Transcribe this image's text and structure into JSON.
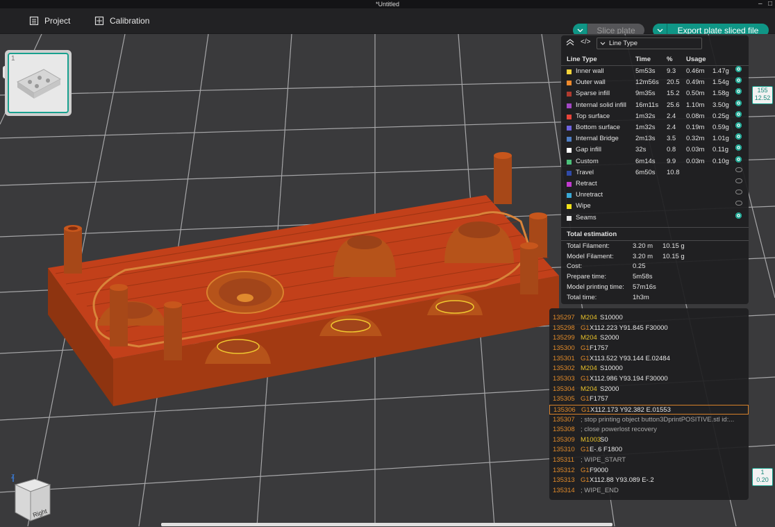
{
  "window": {
    "title": "*Untitled"
  },
  "menubar": {
    "project_label": "Project",
    "calibration_label": "Calibration",
    "slice_label": "Slice plate",
    "export_label": "Export plate sliced file"
  },
  "plate": {
    "number": "1"
  },
  "legend": {
    "view_type": "Line Type",
    "headers": {
      "type": "Line Type",
      "time": "Time",
      "pct": "%",
      "usage": "Usage"
    },
    "rows": [
      {
        "name": "Inner wall",
        "time": "5m53s",
        "pct": "9.3",
        "len": "0.46m",
        "weight": "1.47g",
        "color": "#f5d33a",
        "visible": true
      },
      {
        "name": "Outer wall",
        "time": "12m56s",
        "pct": "20.5",
        "len": "0.49m",
        "weight": "1.54g",
        "color": "#f08a2c",
        "visible": true
      },
      {
        "name": "Sparse infill",
        "time": "9m35s",
        "pct": "15.2",
        "len": "0.50m",
        "weight": "1.58g",
        "color": "#b03a2e",
        "visible": true
      },
      {
        "name": "Internal solid infill",
        "time": "16m11s",
        "pct": "25.6",
        "len": "1.10m",
        "weight": "3.50g",
        "color": "#a347c4",
        "visible": true
      },
      {
        "name": "Top surface",
        "time": "1m32s",
        "pct": "2.4",
        "len": "0.08m",
        "weight": "0.25g",
        "color": "#e8443a",
        "visible": true
      },
      {
        "name": "Bottom surface",
        "time": "1m32s",
        "pct": "2.4",
        "len": "0.19m",
        "weight": "0.59g",
        "color": "#6e64e0",
        "visible": true
      },
      {
        "name": "Internal Bridge",
        "time": "2m13s",
        "pct": "3.5",
        "len": "0.32m",
        "weight": "1.01g",
        "color": "#4f7ec4",
        "visible": true
      },
      {
        "name": "Gap infill",
        "time": "32s",
        "pct": "0.8",
        "len": "0.03m",
        "weight": "0.11g",
        "color": "#ffffff",
        "visible": true
      },
      {
        "name": "Custom",
        "time": "6m14s",
        "pct": "9.9",
        "len": "0.03m",
        "weight": "0.10g",
        "color": "#4bc27a",
        "visible": true
      },
      {
        "name": "Travel",
        "time": "6m50s",
        "pct": "10.8",
        "len": "",
        "weight": "",
        "color": "#2f4aa8",
        "visible": false
      },
      {
        "name": "Retract",
        "time": "",
        "pct": "",
        "len": "",
        "weight": "",
        "color": "#c23ad1",
        "visible": false
      },
      {
        "name": "Unretract",
        "time": "",
        "pct": "",
        "len": "",
        "weight": "",
        "color": "#3aa9d6",
        "visible": false
      },
      {
        "name": "Wipe",
        "time": "",
        "pct": "",
        "len": "",
        "weight": "",
        "color": "#f2e21a",
        "visible": false
      },
      {
        "name": "Seams",
        "time": "",
        "pct": "",
        "len": "",
        "weight": "",
        "color": "#e6e6e6",
        "visible": true
      }
    ]
  },
  "estimation": {
    "title": "Total estimation",
    "rows": [
      {
        "label": "Total Filament:",
        "a": "3.20 m",
        "b": "10.15 g"
      },
      {
        "label": "Model Filament:",
        "a": "3.20 m",
        "b": "10.15 g"
      },
      {
        "label": "Cost:",
        "a": "0.25",
        "b": ""
      },
      {
        "label": "Prepare time:",
        "a": "5m58s",
        "b": ""
      },
      {
        "label": "Model printing time:",
        "a": "57m16s",
        "b": ""
      },
      {
        "label": "Total time:",
        "a": "1h3m",
        "b": ""
      }
    ]
  },
  "gcode": {
    "lines": [
      {
        "n": "135297",
        "cmd": "M204",
        "args": "S10000",
        "kind": "m"
      },
      {
        "n": "135298",
        "cmd": "G1",
        "args": "X112.223 Y91.845 F30000",
        "kind": "g"
      },
      {
        "n": "135299",
        "cmd": "M204",
        "args": "S2000",
        "kind": "m"
      },
      {
        "n": "135300",
        "cmd": "G1",
        "args": "F1757",
        "kind": "g"
      },
      {
        "n": "135301",
        "cmd": "G1",
        "args": "X113.522 Y93.144 E.02484",
        "kind": "g"
      },
      {
        "n": "135302",
        "cmd": "M204",
        "args": "S10000",
        "kind": "m"
      },
      {
        "n": "135303",
        "cmd": "G1",
        "args": "X112.986 Y93.194 F30000",
        "kind": "g"
      },
      {
        "n": "135304",
        "cmd": "M204",
        "args": "S2000",
        "kind": "m"
      },
      {
        "n": "135305",
        "cmd": "G1",
        "args": "F1757",
        "kind": "g"
      },
      {
        "n": "135306",
        "cmd": "G1",
        "args": "X112.173 Y92.382 E.01553",
        "kind": "g",
        "selected": true
      },
      {
        "n": "135307",
        "cmd": "",
        "args": "; stop printing object button3DprintPOSITIVE.stl id:...",
        "kind": "c"
      },
      {
        "n": "135308",
        "cmd": "",
        "args": "; close powerlost recovery",
        "kind": "c"
      },
      {
        "n": "135309",
        "cmd": "M1003",
        "args": "S0",
        "kind": "m"
      },
      {
        "n": "135310",
        "cmd": "G1",
        "args": "E-.6 F1800",
        "kind": "g"
      },
      {
        "n": "135311",
        "cmd": "",
        "args": "; WIPE_START",
        "kind": "c"
      },
      {
        "n": "135312",
        "cmd": "G1",
        "args": "F9000",
        "kind": "g"
      },
      {
        "n": "135313",
        "cmd": "G1",
        "args": "X112.88 Y93.089 E-.2",
        "kind": "g"
      },
      {
        "n": "135314",
        "cmd": "",
        "args": "; WIPE_END",
        "kind": "c"
      }
    ]
  },
  "layer_slider": {
    "top_layer": "155",
    "top_height": "12.52",
    "bottom_layer": "1",
    "bottom_height": "0.20"
  },
  "view_cube": {
    "face_label": "Right",
    "axis_label": "Z"
  }
}
